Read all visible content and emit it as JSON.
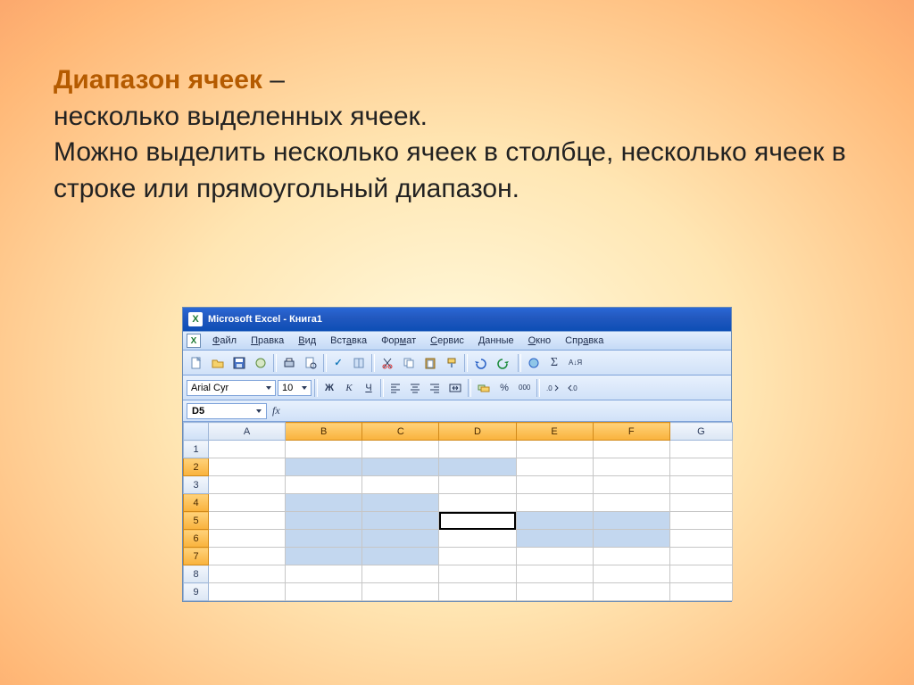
{
  "text": {
    "term": "Диапазон ячеек",
    "dash": "–",
    "line1": "несколько выделенных ячеек.",
    "rest": "Можно выделить несколько ячеек в столбце, несколько ячеек в строке или прямоугольный диапазон."
  },
  "excel": {
    "title": "Microsoft Excel - Книга1",
    "menus": {
      "file": {
        "u": "Ф",
        "rest": "айл"
      },
      "edit": {
        "u": "П",
        "rest": "равка"
      },
      "view": {
        "u": "В",
        "rest": "ид"
      },
      "insert": {
        "u": "",
        "pre": "Вст",
        "u2": "а",
        "rest": "вка"
      },
      "format": {
        "u": "",
        "pre": "Фор",
        "u2": "м",
        "rest": "ат"
      },
      "tools": {
        "u": "С",
        "rest": "ервис"
      },
      "data": {
        "u": "Д",
        "rest": "анные"
      },
      "window": {
        "u": "О",
        "rest": "кно"
      },
      "help": {
        "u": "",
        "pre": "Спр",
        "u2": "а",
        "rest": "вка"
      }
    },
    "font": {
      "name": "Arial Cyr",
      "size": "10"
    },
    "std_labels": {
      "bold": "Ж",
      "italic": "К",
      "underline": "Ч",
      "currency": "₽",
      "percent": "%",
      "thousands": "000"
    },
    "namebox": "D5",
    "fx": "fx",
    "sigma": "Σ",
    "sort_az": "А↓Я",
    "columns": [
      "A",
      "B",
      "C",
      "D",
      "E",
      "F",
      "G"
    ],
    "rows": [
      "1",
      "2",
      "3",
      "4",
      "5",
      "6",
      "7",
      "8",
      "9"
    ],
    "selected_rows": [
      "2",
      "4",
      "5",
      "6",
      "7"
    ],
    "selected_cols": [
      "B",
      "C",
      "D",
      "E",
      "F"
    ],
    "active_cell": "D5",
    "selected_cells": [
      "B2",
      "C2",
      "D2",
      "B4",
      "C4",
      "B5",
      "C5",
      "E5",
      "F5",
      "B6",
      "C6",
      "E6",
      "F6",
      "B7",
      "C7"
    ]
  }
}
